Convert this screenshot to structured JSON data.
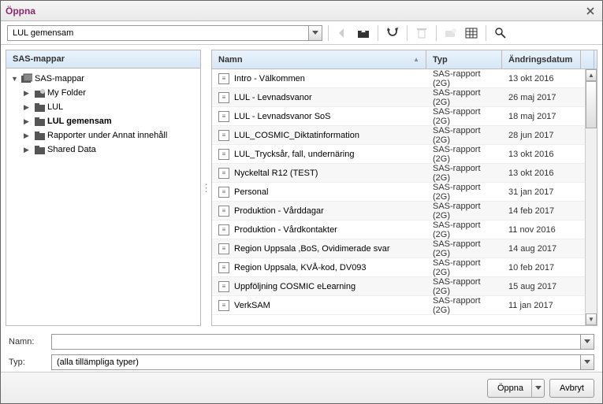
{
  "window": {
    "title": "Öppna"
  },
  "toolbar": {
    "path": "LUL gemensam"
  },
  "tree": {
    "header": "SAS-mappar",
    "root": "SAS-mappar",
    "children": [
      {
        "label": "My Folder"
      },
      {
        "label": "LUL"
      },
      {
        "label": "LUL gemensam",
        "selected": true
      },
      {
        "label": "Rapporter under Annat innehåll"
      },
      {
        "label": "Shared Data"
      }
    ]
  },
  "list": {
    "columns": {
      "name": "Namn",
      "type": "Typ",
      "date": "Ändringsdatum"
    },
    "rows": [
      {
        "name": "Intro - Välkommen",
        "type": "SAS-rapport (2G)",
        "date": "13 okt 2016"
      },
      {
        "name": "LUL - Levnadsvanor",
        "type": "SAS-rapport (2G)",
        "date": "26 maj 2017"
      },
      {
        "name": "LUL - Levnadsvanor SoS",
        "type": "SAS-rapport (2G)",
        "date": "18 maj 2017"
      },
      {
        "name": "LUL_COSMIC_Diktatinformation",
        "type": "SAS-rapport (2G)",
        "date": "28 jun 2017"
      },
      {
        "name": "LUL_Trycksår, fall, undernäring",
        "type": "SAS-rapport (2G)",
        "date": "13 okt 2016"
      },
      {
        "name": "Nyckeltal R12 (TEST)",
        "type": "SAS-rapport (2G)",
        "date": "13 okt 2016"
      },
      {
        "name": "Personal",
        "type": "SAS-rapport (2G)",
        "date": "31 jan 2017"
      },
      {
        "name": "Produktion - Vårddagar",
        "type": "SAS-rapport (2G)",
        "date": "14 feb 2017"
      },
      {
        "name": "Produktion - Vårdkontakter",
        "type": "SAS-rapport (2G)",
        "date": "11 nov 2016"
      },
      {
        "name": "Region Uppsala ,BoS, Ovidimerade svar",
        "type": "SAS-rapport (2G)",
        "date": "14 aug 2017"
      },
      {
        "name": "Region Uppsala, KVÅ-kod, DV093",
        "type": "SAS-rapport (2G)",
        "date": "10 feb 2017"
      },
      {
        "name": "Uppföljning COSMIC eLearning",
        "type": "SAS-rapport (2G)",
        "date": "15 aug 2017"
      },
      {
        "name": "VerkSAM",
        "type": "SAS-rapport (2G)",
        "date": "11 jan 2017"
      }
    ]
  },
  "fields": {
    "name_label": "Namn:",
    "name_value": "",
    "type_label": "Typ:",
    "type_value": "(alla tillämpliga typer)"
  },
  "buttons": {
    "open": "Öppna",
    "cancel": "Avbryt"
  }
}
